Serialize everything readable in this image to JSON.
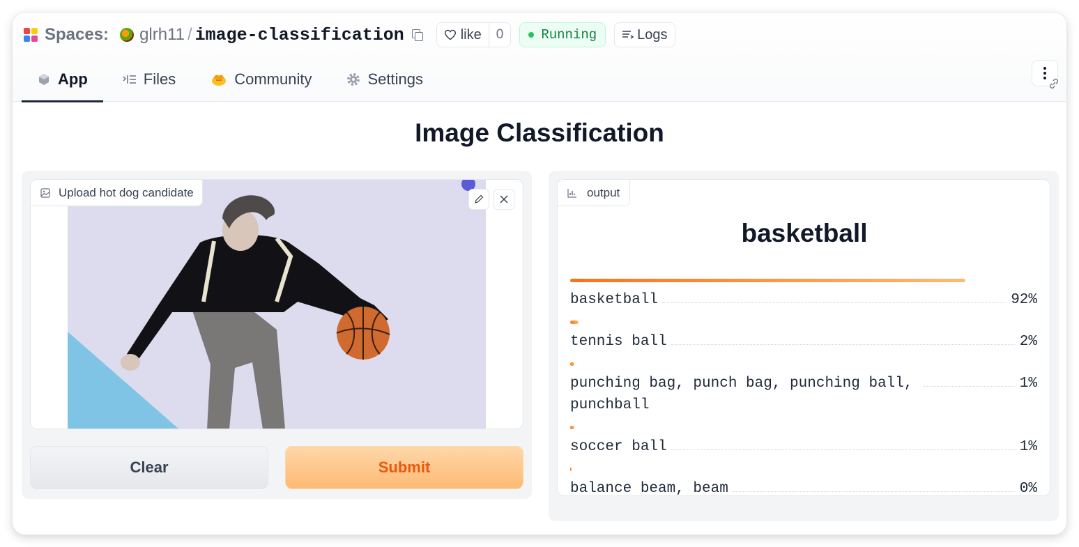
{
  "header": {
    "spaces_label": "Spaces:",
    "owner": "glrh11",
    "separator": "/",
    "repo": "image-classification",
    "like_label": "like",
    "like_count": "0",
    "status": "Running",
    "logs_label": "Logs"
  },
  "tabs": [
    {
      "label": "App",
      "icon": "cube-icon",
      "active": true
    },
    {
      "label": "Files",
      "icon": "files-icon",
      "active": false
    },
    {
      "label": "Community",
      "icon": "community-icon",
      "active": false
    },
    {
      "label": "Settings",
      "icon": "gear-icon",
      "active": false
    }
  ],
  "main": {
    "title": "Image Classification",
    "input_label": "Upload hot dog candidate",
    "clear_label": "Clear",
    "submit_label": "Submit",
    "output_label": "output",
    "top_class": "basketball"
  },
  "predictions": [
    {
      "label": "basketball",
      "value": "92%",
      "fraction": 0.92
    },
    {
      "label": "tennis ball",
      "value": "2%",
      "fraction": 0.02
    },
    {
      "label": "punching bag, punch bag, punching ball, punchball",
      "value": "1%",
      "fraction": 0.01
    },
    {
      "label": "soccer ball",
      "value": "1%",
      "fraction": 0.01
    },
    {
      "label": "balance beam, beam",
      "value": "0%",
      "fraction": 0.003
    }
  ],
  "colors": {
    "accent": "#ea580c",
    "status_green": "#22c55e",
    "bar_start": "#f97316",
    "bar_end": "#fdba74"
  }
}
